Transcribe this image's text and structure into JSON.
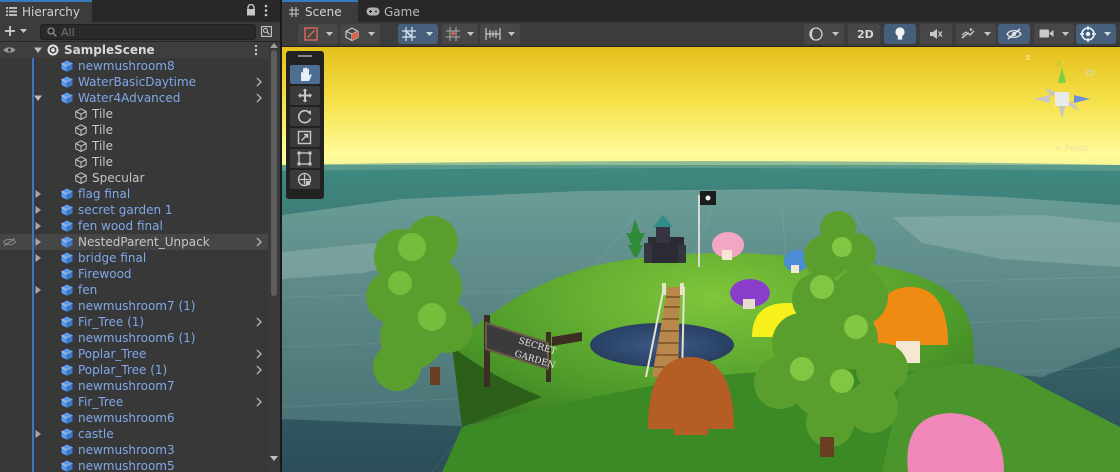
{
  "hierarchy": {
    "tab_label": "Hierarchy",
    "search_placeholder": "All",
    "scene_name": "SampleScene",
    "rows": [
      {
        "label": "newmushroom8",
        "indent": 0,
        "fold": "none",
        "arrow": false,
        "color": "prefab",
        "icon": "prefab"
      },
      {
        "label": "WaterBasicDaytime",
        "indent": 0,
        "fold": "none",
        "arrow": true,
        "color": "prefab",
        "icon": "prefab"
      },
      {
        "label": "Water4Advanced",
        "indent": 0,
        "fold": "open",
        "arrow": true,
        "color": "prefab",
        "icon": "prefab"
      },
      {
        "label": "Tile",
        "indent": 1,
        "fold": "none",
        "arrow": false,
        "color": "plain",
        "icon": "object"
      },
      {
        "label": "Tile",
        "indent": 1,
        "fold": "none",
        "arrow": false,
        "color": "plain",
        "icon": "object"
      },
      {
        "label": "Tile",
        "indent": 1,
        "fold": "none",
        "arrow": false,
        "color": "plain",
        "icon": "object"
      },
      {
        "label": "Tile",
        "indent": 1,
        "fold": "none",
        "arrow": false,
        "color": "plain",
        "icon": "object"
      },
      {
        "label": "Specular",
        "indent": 1,
        "fold": "none",
        "arrow": false,
        "color": "plain",
        "icon": "object"
      },
      {
        "label": "flag final",
        "indent": 0,
        "fold": "closed",
        "arrow": false,
        "color": "prefab",
        "icon": "prefab"
      },
      {
        "label": "secret garden 1",
        "indent": 0,
        "fold": "closed",
        "arrow": false,
        "color": "prefab",
        "icon": "prefab"
      },
      {
        "label": "fen wood final",
        "indent": 0,
        "fold": "closed",
        "arrow": false,
        "color": "prefab",
        "icon": "prefab"
      },
      {
        "label": "NestedParent_Unpack",
        "indent": 0,
        "fold": "closed",
        "arrow": true,
        "color": "plain",
        "icon": "prefab",
        "selected": true,
        "hidden": true
      },
      {
        "label": "bridge final",
        "indent": 0,
        "fold": "closed",
        "arrow": false,
        "color": "prefab",
        "icon": "prefab"
      },
      {
        "label": "Firewood",
        "indent": 0,
        "fold": "none",
        "arrow": false,
        "color": "prefab",
        "icon": "prefab"
      },
      {
        "label": "fen",
        "indent": 0,
        "fold": "closed",
        "arrow": false,
        "color": "prefab",
        "icon": "prefab"
      },
      {
        "label": "newmushroom7 (1)",
        "indent": 0,
        "fold": "none",
        "arrow": false,
        "color": "prefab",
        "icon": "prefab"
      },
      {
        "label": "Fir_Tree (1)",
        "indent": 0,
        "fold": "none",
        "arrow": true,
        "color": "prefab",
        "icon": "prefab"
      },
      {
        "label": "newmushroom6 (1)",
        "indent": 0,
        "fold": "none",
        "arrow": false,
        "color": "prefab",
        "icon": "prefab"
      },
      {
        "label": "Poplar_Tree",
        "indent": 0,
        "fold": "none",
        "arrow": true,
        "color": "prefab",
        "icon": "prefab"
      },
      {
        "label": "Poplar_Tree (1)",
        "indent": 0,
        "fold": "none",
        "arrow": true,
        "color": "prefab",
        "icon": "prefab"
      },
      {
        "label": "newmushroom7",
        "indent": 0,
        "fold": "none",
        "arrow": false,
        "color": "prefab",
        "icon": "prefab"
      },
      {
        "label": "Fir_Tree",
        "indent": 0,
        "fold": "none",
        "arrow": true,
        "color": "prefab",
        "icon": "prefab"
      },
      {
        "label": "newmushroom6",
        "indent": 0,
        "fold": "none",
        "arrow": false,
        "color": "prefab",
        "icon": "prefab"
      },
      {
        "label": "castle",
        "indent": 0,
        "fold": "closed",
        "arrow": false,
        "color": "prefab",
        "icon": "prefab"
      },
      {
        "label": "newmushroom3",
        "indent": 0,
        "fold": "none",
        "arrow": false,
        "color": "prefab",
        "icon": "prefab"
      },
      {
        "label": "newmushroom5",
        "indent": 0,
        "fold": "none",
        "arrow": false,
        "color": "prefab",
        "icon": "prefab"
      }
    ]
  },
  "scene_view": {
    "tabs": [
      {
        "label": "Scene",
        "icon": "grid-icon",
        "active": true
      },
      {
        "label": "Game",
        "icon": "gamepad-icon",
        "active": false
      }
    ],
    "toolbar": {
      "mode_2d_label": "2D",
      "left_groups": [
        "draw-mode",
        "render-mode",
        "grid-snap",
        "increment-snap",
        "align-tools"
      ],
      "right_groups": [
        "shading",
        "2d-toggle",
        "lighting",
        "audio",
        "effects",
        "visibility",
        "camera",
        "gizmos"
      ]
    },
    "transform_tools": [
      "view-tool",
      "move-tool",
      "rotate-tool",
      "scale-tool",
      "rect-tool",
      "transform-tool"
    ],
    "gizmo_label": "< Persp",
    "sign_text": [
      "SECRET",
      "GARDEN"
    ],
    "colors": {
      "accent": "#3a79bb",
      "prefab_text": "#7fa7ea",
      "sky_top": "#e6c21a",
      "sky_horizon": "#fffb9a",
      "water": "#3e7f77"
    }
  }
}
